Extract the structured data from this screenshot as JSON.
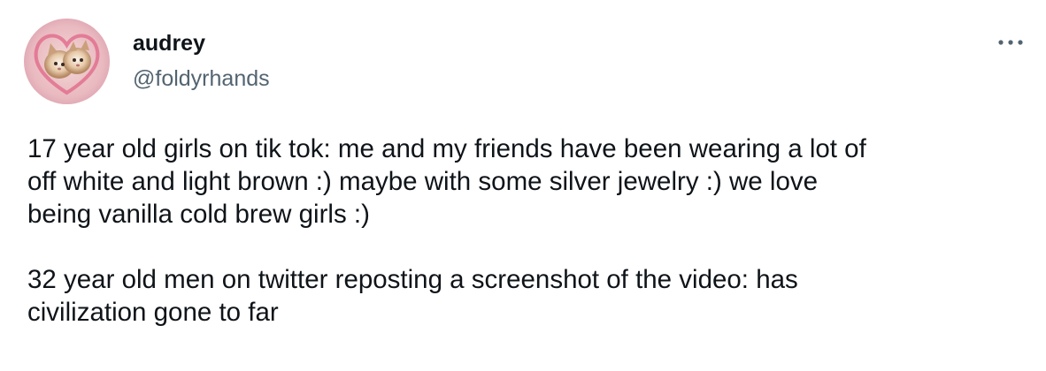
{
  "author": {
    "display_name": "audrey",
    "handle": "@foldyrhands",
    "avatar_icon": "cat-heart-avatar"
  },
  "menu": {
    "icon": "more-options-icon"
  },
  "tweet": {
    "paragraphs": [
      "17 year old girls on tik tok: me and my friends have been wearing a lot of\noff white and light brown :) maybe with some silver jewelry :) we love\nbeing vanilla cold brew girls :)",
      "32 year old men on twitter reposting a screenshot of the video: has\ncivilization gone to far"
    ]
  },
  "colors": {
    "text": "#0f1419",
    "secondary": "#536471",
    "background": "#ffffff"
  }
}
